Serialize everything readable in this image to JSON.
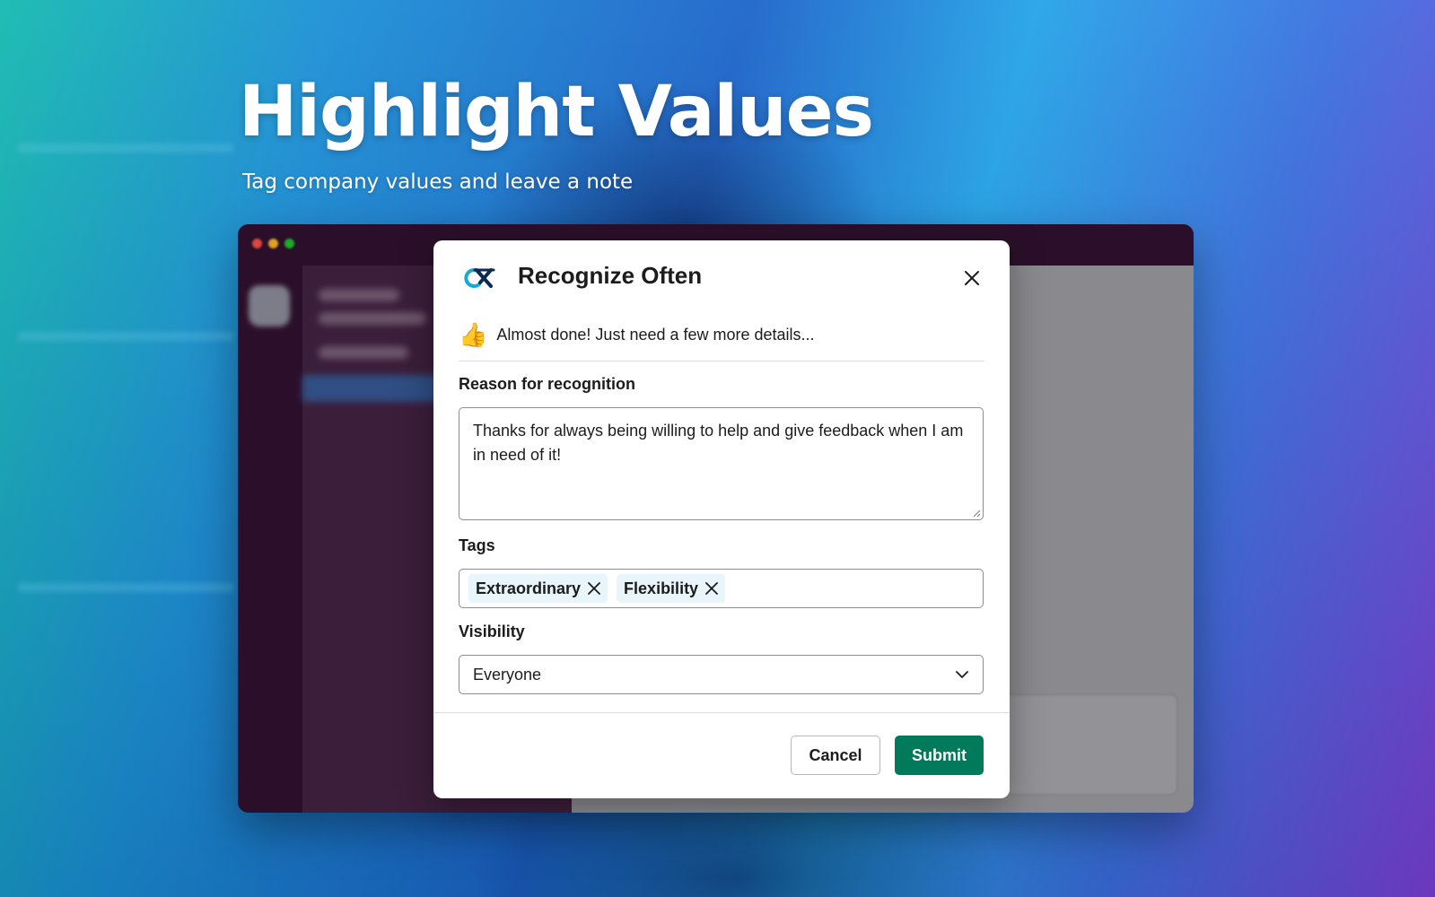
{
  "hero": {
    "title": "Highlight Values",
    "subtitle": "Tag company values and leave a note"
  },
  "modal": {
    "title": "Recognize Often",
    "logo_icon": "recognize-often-logo",
    "notice_icon": "thumbs-up-icon",
    "notice_text": "Almost done! Just need a few more details...",
    "reason": {
      "label": "Reason for recognition",
      "value": "Thanks for always being willing to help and give feedback when I am in need of it!"
    },
    "tags": {
      "label": "Tags",
      "items": [
        "Extraordinary",
        "Flexibility"
      ]
    },
    "visibility": {
      "label": "Visibility",
      "selected": "Everyone"
    },
    "buttons": {
      "cancel": "Cancel",
      "submit": "Submit"
    }
  },
  "colors": {
    "submit": "#007a5a",
    "tag_bg": "#e8f5fa",
    "app_sidebar": "#3b1e3a"
  }
}
